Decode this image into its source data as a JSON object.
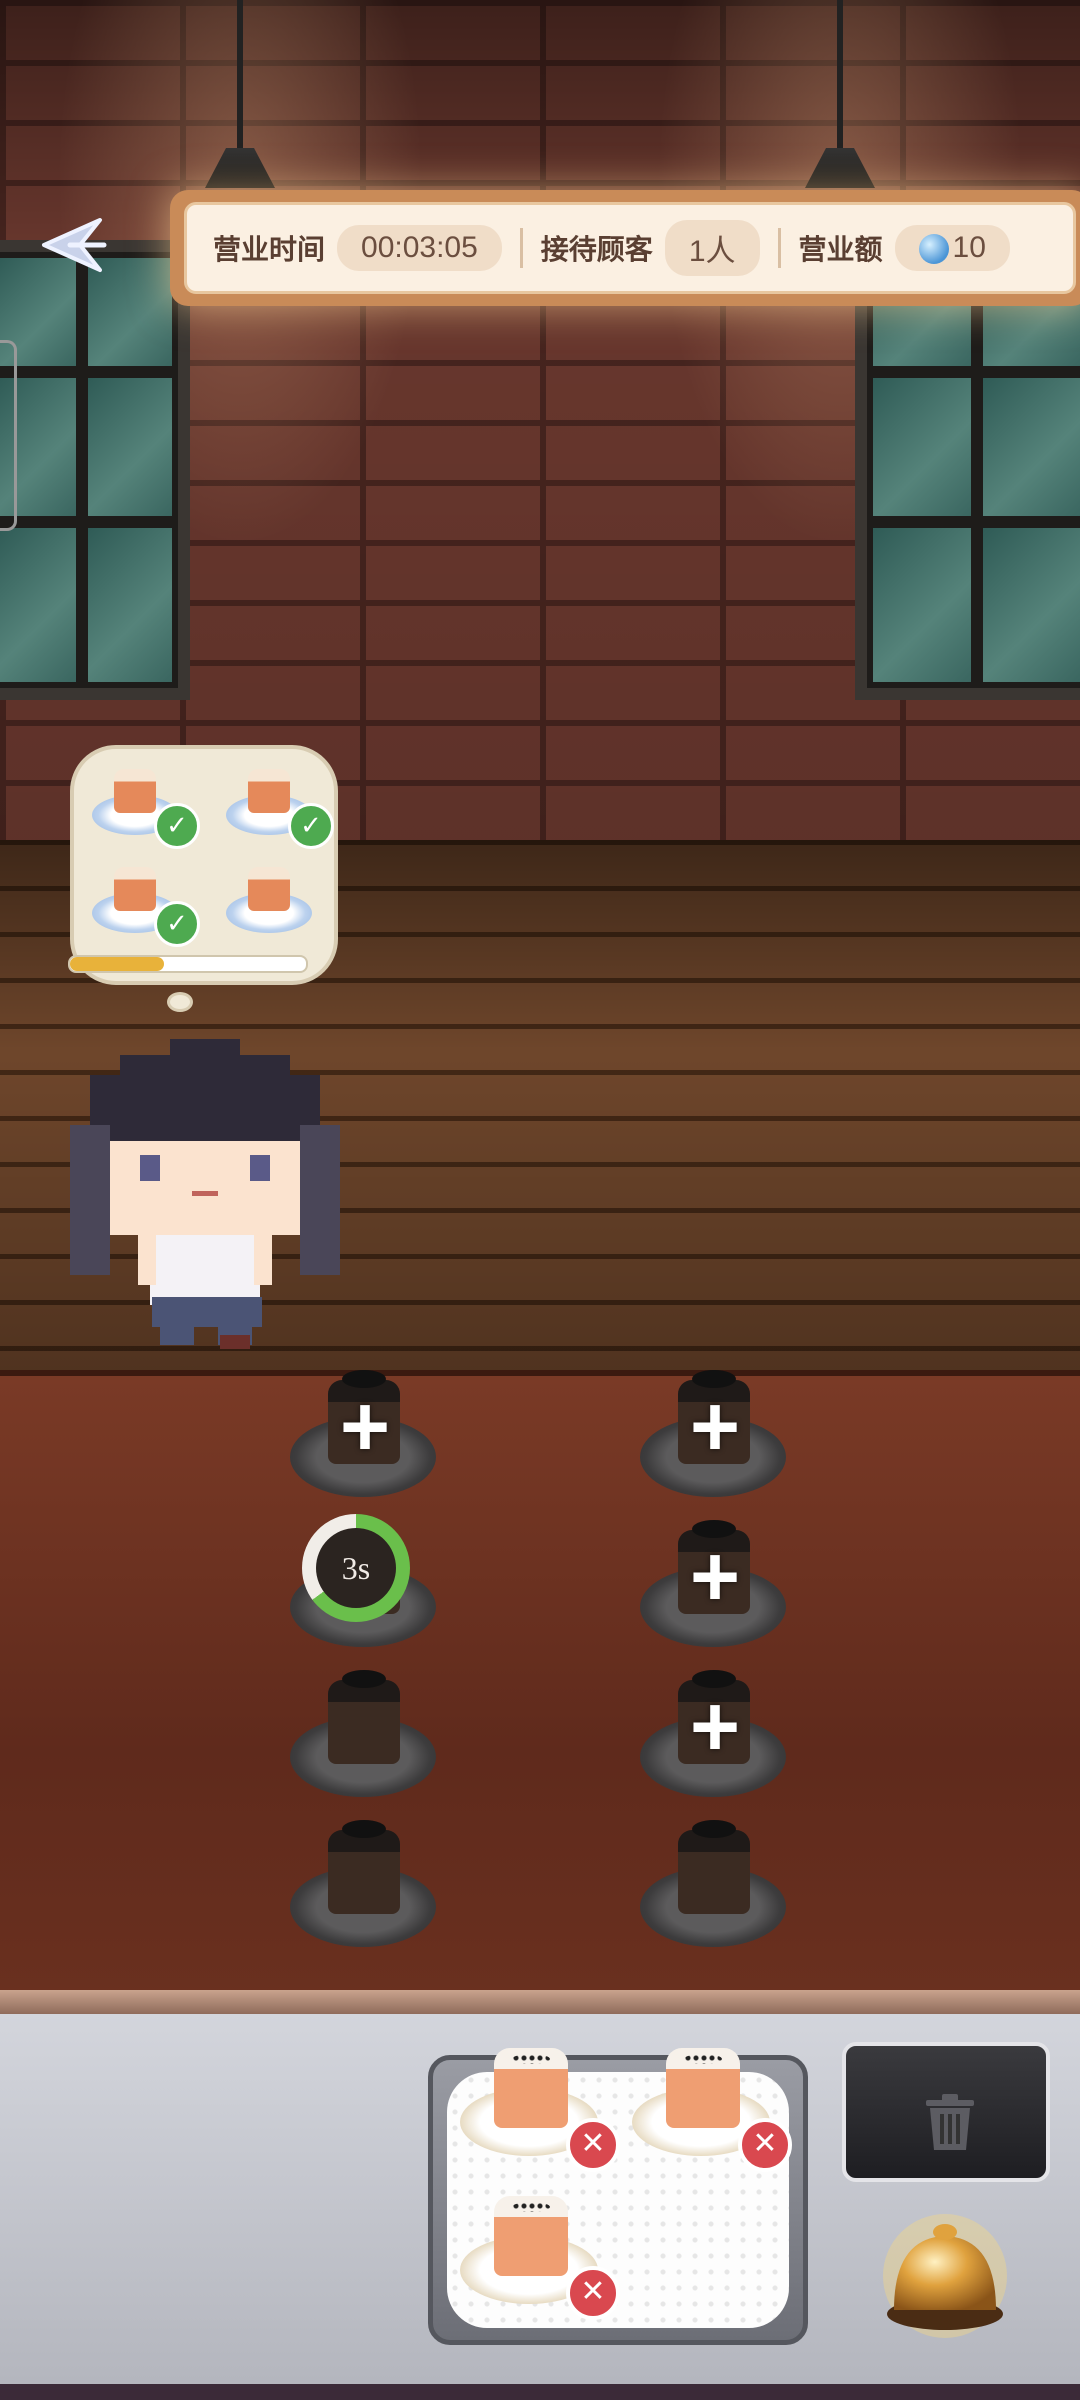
{
  "hud": {
    "time_label": "营业时间",
    "time_value": "00:03:05",
    "customers_label": "接待顾客",
    "customers_value": "1人",
    "revenue_label": "营业额",
    "revenue_value": "10"
  },
  "order": {
    "items": [
      {
        "dish": "cake",
        "done": true
      },
      {
        "dish": "cake",
        "done": true
      },
      {
        "dish": "cake",
        "done": true
      },
      {
        "dish": "cake",
        "done": false
      }
    ],
    "patience_progress": 0.4
  },
  "counter": {
    "slots": [
      {
        "state": "add"
      },
      {
        "state": "add"
      },
      {
        "state": "timer",
        "timer_text": "3s",
        "timer_progress": 0.65
      },
      {
        "state": "add"
      },
      {
        "state": "ready"
      },
      {
        "state": "add"
      },
      {
        "state": "ready"
      },
      {
        "state": "ready"
      }
    ]
  },
  "tray": {
    "items": [
      {
        "dish": "cake"
      },
      {
        "dish": "cake"
      },
      {
        "dish": "cake"
      }
    ]
  },
  "icons": {
    "back": "back-arrow-icon",
    "revenue": "gem-icon",
    "check": "check-icon",
    "add": "plus-icon",
    "remove": "close-icon",
    "trash": "trash-icon",
    "bell": "service-bell-icon"
  },
  "colors": {
    "check_green": "#4eaa50",
    "remove_red": "#d9484f",
    "progress_yellow": "#e8b23a",
    "timer_green": "#6abf4b"
  }
}
